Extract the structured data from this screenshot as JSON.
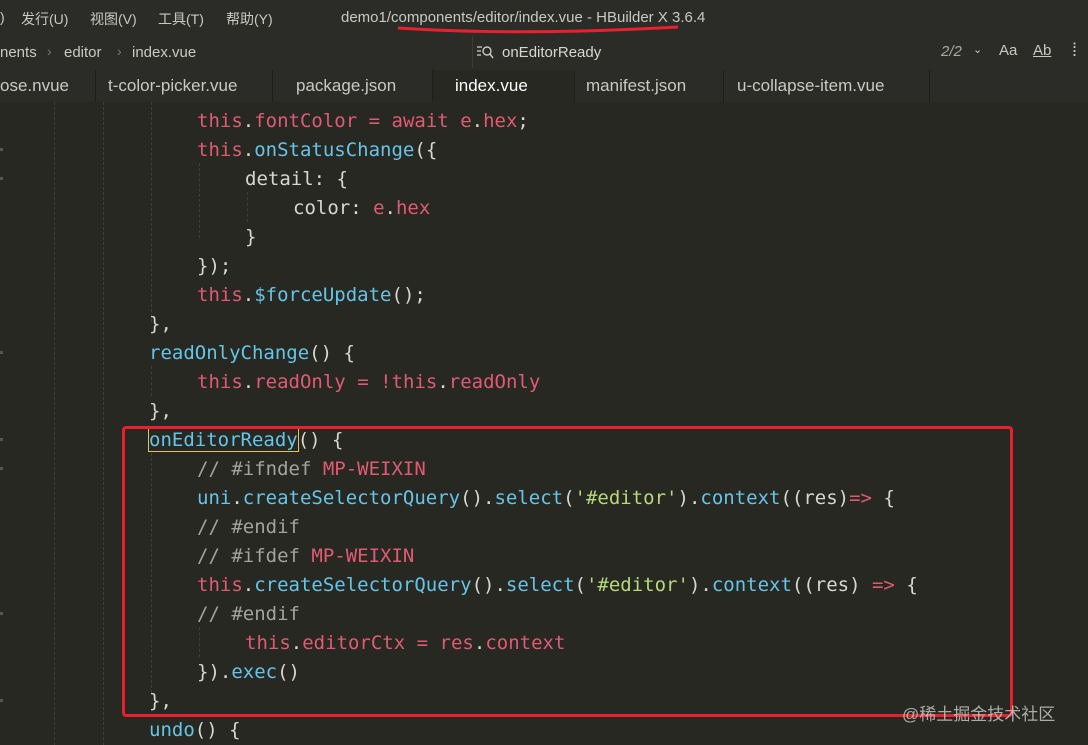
{
  "menu": {
    "fragment": ")",
    "items": [
      "发行(U)",
      "视图(V)",
      "工具(T)",
      "帮助(Y)"
    ],
    "window_title": "demo1/components/editor/index.vue - HBuilder X 3.6.4"
  },
  "breadcrumb": {
    "items": [
      "nents",
      "editor",
      "index.vue"
    ]
  },
  "search": {
    "query": "onEditorReady",
    "match_count": "2/2",
    "match_case_label": "Aa",
    "whole_word_label": "Ab"
  },
  "tabs": [
    {
      "label": "ose.nvue",
      "active": false
    },
    {
      "label": "t-color-picker.vue",
      "active": false
    },
    {
      "label": "package.json",
      "active": false
    },
    {
      "label": "index.vue",
      "active": true
    },
    {
      "label": "manifest.json",
      "active": false
    },
    {
      "label": "u-collapse-item.vue",
      "active": false
    }
  ],
  "code_lines": [
    "this.fontColor = await e.hex;",
    "this.onStatusChange({",
    "detail: {",
    "color: e.hex",
    "}",
    "});",
    "this.$forceUpdate();",
    "},",
    "readOnlyChange() {",
    "this.readOnly = !this.readOnly",
    "},",
    "onEditorReady() {",
    "// #ifndef MP-WEIXIN",
    "uni.createSelectorQuery().select('#editor').context((res)=> {",
    "// #endif",
    "// #ifdef MP-WEIXIN",
    "this.createSelectorQuery().select('#editor').context((res) => {",
    "// #endif",
    "this.editorCtx = res.context",
    "}).exec()",
    "},",
    "undo() {"
  ],
  "watermark": "@稀土掘金技术社区",
  "colors": {
    "editor_bg": "#272822",
    "chrome_bg": "#2b2c27",
    "keyword": "#e15a73",
    "function": "#66c4e8",
    "string": "#b6d97a",
    "annotation_red": "#e8202f",
    "match_highlight": "#e4c455"
  }
}
